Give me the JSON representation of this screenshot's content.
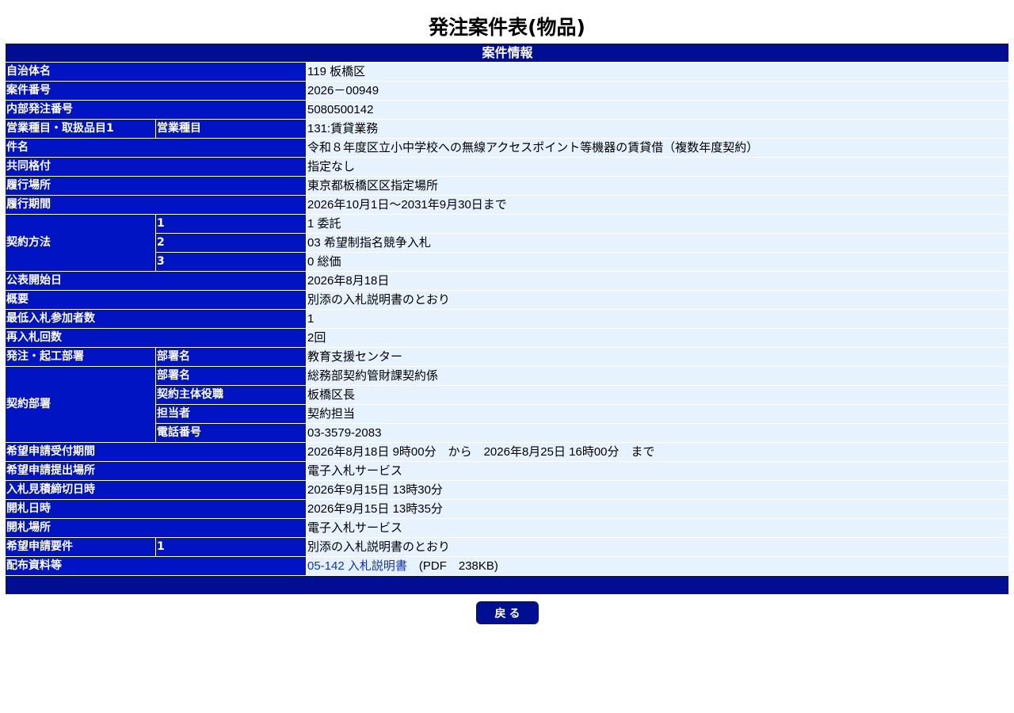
{
  "title": "発注案件表(物品)",
  "section_header": "案件情報",
  "rows": {
    "municipality": {
      "label": "自治体名",
      "value": "119 板橋区"
    },
    "case_number": {
      "label": "案件番号",
      "value": "2026－00949"
    },
    "internal_order_number": {
      "label": "内部発注番号",
      "value": "5080500142"
    },
    "business_category": {
      "label": "営業種目・取扱品目1",
      "sublabel": "営業種目",
      "value": "131:賃貸業務"
    },
    "subject": {
      "label": "件名",
      "value": "令和８年度区立小中学校への無線アクセスポイント等機器の賃貸借（複数年度契約）"
    },
    "joint_rating": {
      "label": "共同格付",
      "value": "指定なし"
    },
    "performance_place": {
      "label": "履行場所",
      "value": "東京都板橋区区指定場所"
    },
    "performance_period": {
      "label": "履行期間",
      "value": "2026年10月1日～2031年9月30日まで"
    },
    "contract_method": {
      "label": "契約方法",
      "items": [
        {
          "num": "1",
          "value": "1 委託"
        },
        {
          "num": "2",
          "value": "03 希望制指名競争入札"
        },
        {
          "num": "3",
          "value": "0 総価"
        }
      ]
    },
    "publication_start": {
      "label": "公表開始日",
      "value": "2026年8月18日"
    },
    "overview": {
      "label": "概要",
      "value": "別添の入札説明書のとおり"
    },
    "min_bidders": {
      "label": "最低入札参加者数",
      "value": "1"
    },
    "rebid_count": {
      "label": "再入札回数",
      "value": "2回"
    },
    "ordering_dept": {
      "label": "発注・起工部署",
      "sublabel": "部署名",
      "value": "教育支援センター"
    },
    "contract_dept": {
      "label": "契約部署",
      "items": [
        {
          "sublabel": "部署名",
          "value": "総務部契約管財課契約係"
        },
        {
          "sublabel": "契約主体役職",
          "value": "板橋区長"
        },
        {
          "sublabel": "担当者",
          "value": "契約担当"
        },
        {
          "sublabel": "電話番号",
          "value": "03-3579-2083"
        }
      ]
    },
    "application_period": {
      "label": "希望申請受付期間",
      "value": "2026年8月18日 9時00分　から　2026年8月25日 16時00分　まで"
    },
    "application_place": {
      "label": "希望申請提出場所",
      "value": "電子入札サービス"
    },
    "bid_deadline": {
      "label": "入札見積締切日時",
      "value": "2026年9月15日 13時30分"
    },
    "opening_datetime": {
      "label": "開札日時",
      "value": "2026年9月15日 13時35分"
    },
    "opening_place": {
      "label": "開札場所",
      "value": "電子入札サービス"
    },
    "application_requirements": {
      "label": "希望申請要件",
      "num": "1",
      "value": "別添の入札説明書のとおり"
    },
    "distribution_materials": {
      "label": "配布資料等",
      "link_text": "05-142 入札説明書",
      "file_info": "　(PDF　238KB)"
    }
  },
  "back_button_label": "戻る",
  "colors": {
    "header_bg": "#000e92",
    "label_bg": "#0014c4",
    "value_bg": "#e7f2ff"
  }
}
